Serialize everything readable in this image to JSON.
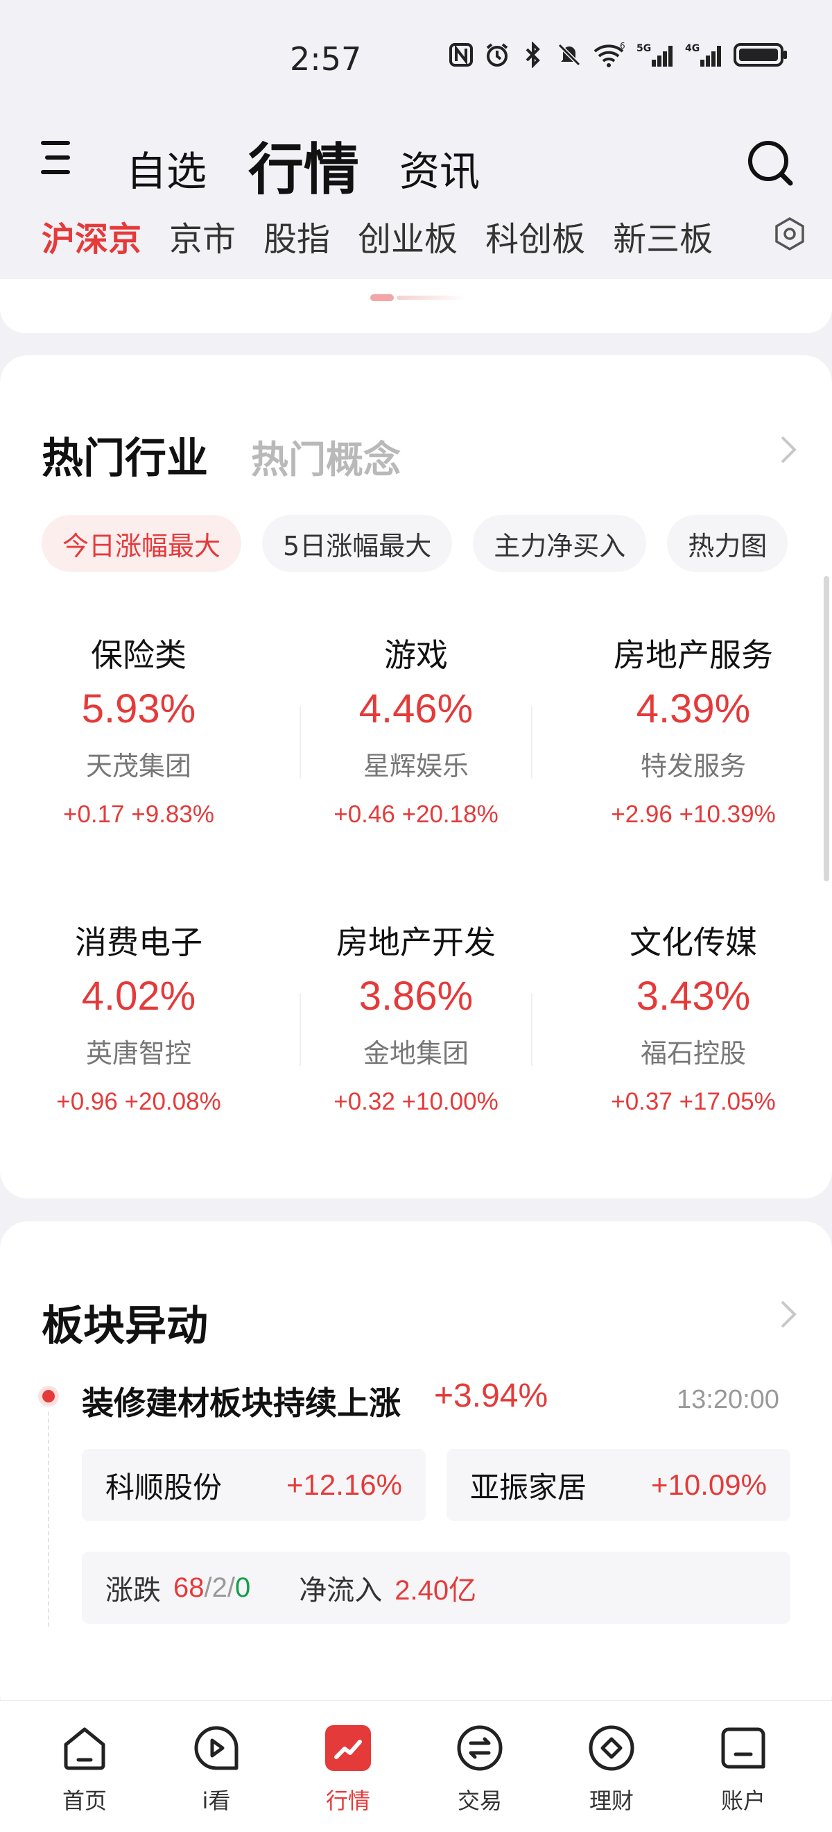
{
  "status_bar": {
    "time": "2:57",
    "icons": [
      "nfc-icon",
      "alarm-icon",
      "bluetooth-icon",
      "mute-icon",
      "wifi-icon",
      "signal-5g-icon",
      "signal-4g-icon",
      "battery-icon"
    ],
    "wifi_label": "6",
    "net1": "5G",
    "net2": "4G"
  },
  "top_nav": {
    "tabs": [
      "自选",
      "行情",
      "资讯"
    ],
    "active_tab": "行情"
  },
  "sub_tabs": [
    "沪深京",
    "京市",
    "股指",
    "创业板",
    "科创板",
    "新三板"
  ],
  "hot_section": {
    "title": "热门行业",
    "alt_title": "热门概念",
    "filters": [
      "今日涨幅最大",
      "5日涨幅最大",
      "主力净买入",
      "热力图"
    ],
    "industries": [
      {
        "name": "保险类",
        "pct": "5.93%",
        "leader": "天茂集团",
        "leader_chg": "+0.17 +9.83%"
      },
      {
        "name": "游戏",
        "pct": "4.46%",
        "leader": "星辉娱乐",
        "leader_chg": "+0.46 +20.18%"
      },
      {
        "name": "房地产服务",
        "pct": "4.39%",
        "leader": "特发服务",
        "leader_chg": "+2.96 +10.39%"
      },
      {
        "name": "消费电子",
        "pct": "4.02%",
        "leader": "英唐智控",
        "leader_chg": "+0.96 +20.08%"
      },
      {
        "name": "房地产开发",
        "pct": "3.86%",
        "leader": "金地集团",
        "leader_chg": "+0.32 +10.00%"
      },
      {
        "name": "文化传媒",
        "pct": "3.43%",
        "leader": "福石控股",
        "leader_chg": "+0.37 +17.05%"
      }
    ]
  },
  "movement_section": {
    "title": "板块异动",
    "event": {
      "title": "装修建材板块持续上涨",
      "change": "+3.94%",
      "time": "13:20:00",
      "stocks": [
        {
          "name": "科顺股份",
          "change": "+12.16%"
        },
        {
          "name": "亚振家居",
          "change": "+10.09%"
        }
      ],
      "stats": {
        "updown_label": "涨跌",
        "up": "68",
        "sep1": "/",
        "flat": "2",
        "sep2": "/",
        "down": "0",
        "netflow_label": "净流入",
        "netflow": "2.40亿"
      }
    }
  },
  "bottom_nav": [
    {
      "label": "首页",
      "icon": "home-icon"
    },
    {
      "label": "i看",
      "icon": "play-icon"
    },
    {
      "label": "行情",
      "icon": "market-icon"
    },
    {
      "label": "交易",
      "icon": "trade-icon"
    },
    {
      "label": "理财",
      "icon": "wealth-icon"
    },
    {
      "label": "账户",
      "icon": "account-icon"
    }
  ],
  "colors": {
    "accent": "#e53a3a",
    "down": "#13a04c",
    "muted": "#999999"
  }
}
